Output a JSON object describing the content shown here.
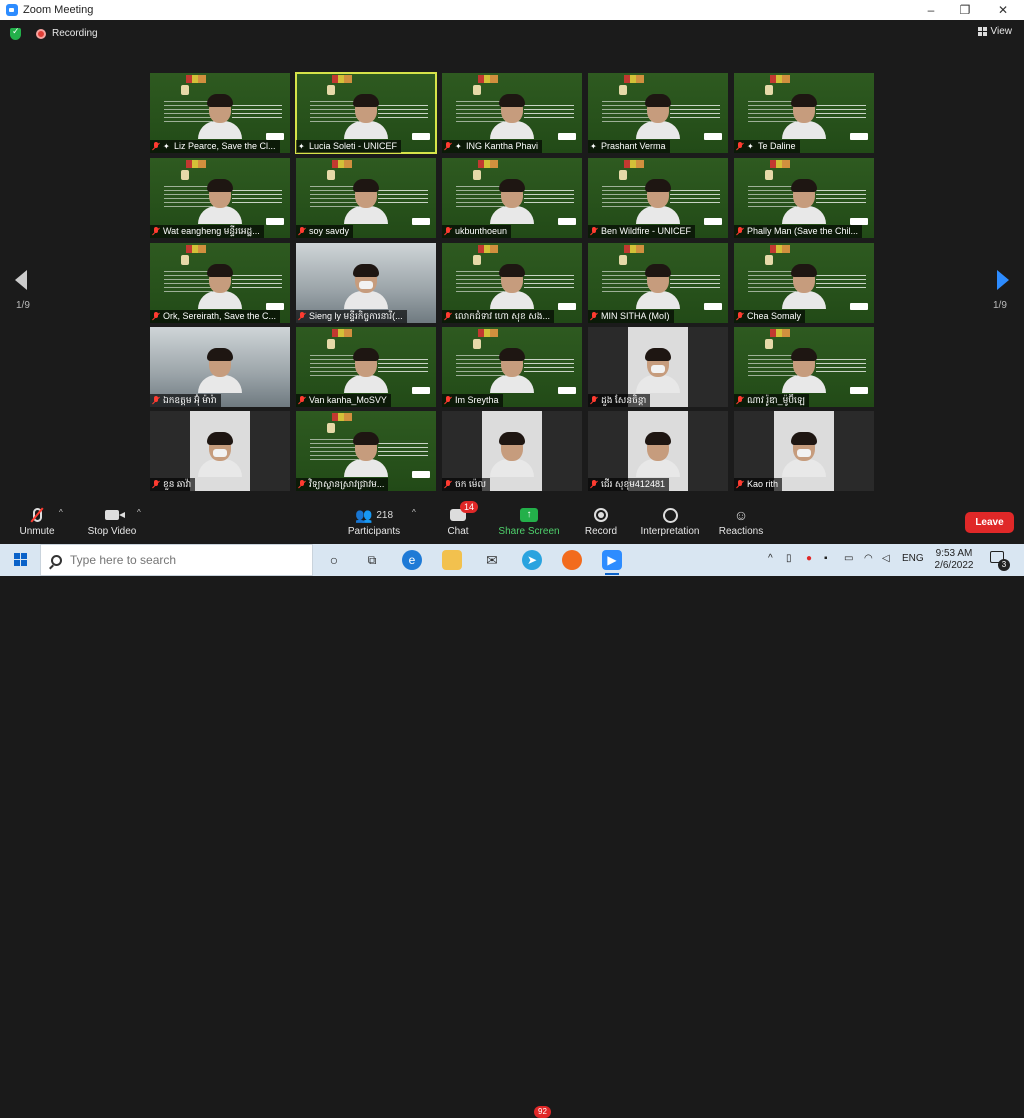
{
  "window": {
    "title": "Zoom Meeting",
    "controls": [
      "–",
      "❐",
      "✕"
    ]
  },
  "topbar": {
    "recording_label": "Recording",
    "view_label": "View"
  },
  "pagination": {
    "left_label": "1/9",
    "right_label": "1/9"
  },
  "participants_tiles": [
    {
      "name": "Liz Pearce, Save the Cl...",
      "muted": true,
      "pinned": true,
      "style": "banner",
      "masked": false
    },
    {
      "name": "Lucia Soleti - UNICEF",
      "muted": false,
      "pinned": true,
      "style": "banner",
      "masked": false,
      "active": true
    },
    {
      "name": "ING Kantha Phavi",
      "muted": true,
      "pinned": true,
      "style": "banner",
      "masked": false
    },
    {
      "name": "Prashant Verma",
      "muted": false,
      "pinned": true,
      "style": "banner",
      "masked": false
    },
    {
      "name": "Te Daline",
      "muted": true,
      "pinned": true,
      "style": "banner",
      "masked": false
    },
    {
      "name": "Wat eangheng  មន្ទីរអេដ្ឋ...",
      "muted": true,
      "pinned": false,
      "style": "banner",
      "masked": false
    },
    {
      "name": "soy savdy",
      "muted": true,
      "pinned": false,
      "style": "banner",
      "masked": false
    },
    {
      "name": "ukbunthoeun",
      "muted": true,
      "pinned": false,
      "style": "banner",
      "masked": false
    },
    {
      "name": "Ben Wildfire - UNICEF",
      "muted": true,
      "pinned": false,
      "style": "banner",
      "masked": false
    },
    {
      "name": "Phally Man (Save the Chil...",
      "muted": true,
      "pinned": false,
      "style": "banner",
      "masked": false
    },
    {
      "name": "Ork, Sereirath, Save the C...",
      "muted": true,
      "pinned": false,
      "style": "banner",
      "masked": false
    },
    {
      "name": "Sieng ly មន្ទីរកិច្ចការនារី(...",
      "muted": true,
      "pinned": false,
      "style": "room",
      "masked": true
    },
    {
      "name": "លោកជំទាវ ហោ សុខ សង...",
      "muted": true,
      "pinned": false,
      "style": "banner",
      "masked": false
    },
    {
      "name": "MIN SITHA (MoI)",
      "muted": true,
      "pinned": false,
      "style": "banner",
      "masked": false
    },
    {
      "name": "Chea Somaly",
      "muted": true,
      "pinned": false,
      "style": "banner",
      "masked": false
    },
    {
      "name": "ឯកឧត្តម អ៊ុំ ម៉ារ៉ា",
      "muted": true,
      "pinned": false,
      "style": "room",
      "masked": false
    },
    {
      "name": "Van kanha_MoSVY",
      "muted": true,
      "pinned": false,
      "style": "banner",
      "masked": false
    },
    {
      "name": "Im Sreytha",
      "muted": true,
      "pinned": false,
      "style": "banner",
      "masked": false
    },
    {
      "name": "ដួង សែនចិន្តា",
      "muted": true,
      "pinned": false,
      "style": "dark",
      "masked": true
    },
    {
      "name": "ណាវ រ៉ូឌា_ម៉ូប៊ីឡេ",
      "muted": true,
      "pinned": false,
      "style": "banner",
      "masked": false
    },
    {
      "name": "ខួន ឆាវ៉ា",
      "muted": true,
      "pinned": false,
      "style": "dark",
      "masked": true
    },
    {
      "name": "វិទ្យាស្ថានស្រាវជ្រាវម...",
      "muted": true,
      "pinned": false,
      "style": "banner",
      "masked": false
    },
    {
      "name": "ចក ម៉េល",
      "muted": true,
      "pinned": false,
      "style": "dark",
      "masked": false
    },
    {
      "name": "ជើរ សុខុម412481",
      "muted": true,
      "pinned": false,
      "style": "dark",
      "masked": false
    },
    {
      "name": "Kao rith",
      "muted": true,
      "pinned": false,
      "style": "dark",
      "masked": true
    }
  ],
  "toolbar": {
    "unmute_label": "Unmute",
    "stop_video_label": "Stop Video",
    "participants_label": "Participants",
    "participants_count": "218",
    "chat_label": "Chat",
    "chat_badge": "14",
    "share_label": "Share Screen",
    "record_label": "Record",
    "interpretation_label": "Interpretation",
    "reactions_label": "Reactions",
    "leave_label": "Leave"
  },
  "taskbar": {
    "search_placeholder": "Type here to search",
    "telegram_badge": "92",
    "language": "ENG",
    "time": "9:53 AM",
    "date": "2/6/2022",
    "notification_count": "3"
  },
  "colors": {
    "zoom_blue": "#2d8cff",
    "leave_red": "#e02828",
    "share_green": "#23b04a",
    "active_outline": "#d6e34a"
  }
}
